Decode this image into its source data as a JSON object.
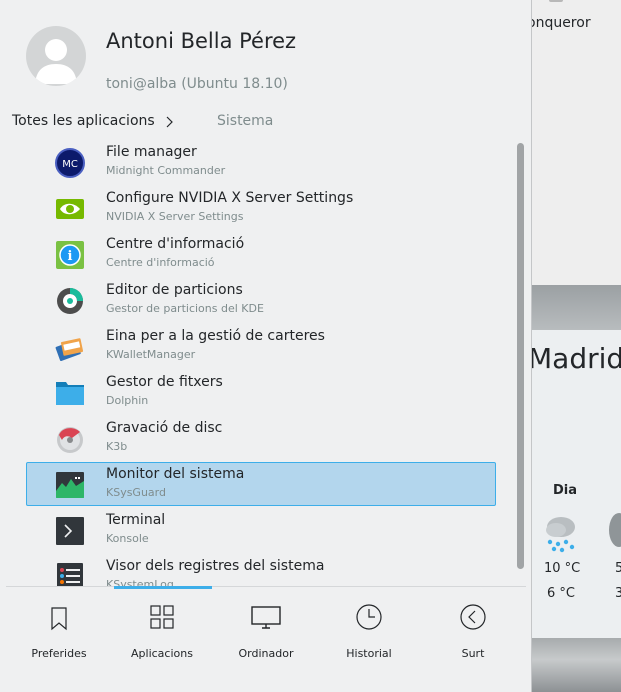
{
  "background": {
    "window_title_fragment": "onqueror",
    "weather": {
      "city": "Madrid",
      "day_label": "Dia",
      "high": "10 °C",
      "low": "6 °C",
      "next_high": "5",
      "next_low": "3"
    }
  },
  "user": {
    "name": "Antoni Bella Pérez",
    "host": "toni@alba (Ubuntu 18.10)",
    "avatar_icon": "user-avatar-icon"
  },
  "breadcrumb": {
    "root": "Totes les aplicacions",
    "separator_icon": "chevron-right-icon",
    "current": "Sistema"
  },
  "apps": [
    {
      "name": "File manager",
      "description": "Midnight Commander",
      "icon": "midnight-commander-icon"
    },
    {
      "name": "Configure NVIDIA X Server Settings",
      "description": "NVIDIA X Server Settings",
      "icon": "nvidia-icon"
    },
    {
      "name": "Centre d'informació",
      "description": "Centre d'informació",
      "icon": "info-center-icon"
    },
    {
      "name": "Editor de particions",
      "description": "Gestor de particions del KDE",
      "icon": "partition-manager-icon"
    },
    {
      "name": "Eina per a la gestió de carteres",
      "description": "KWalletManager",
      "icon": "kwallet-icon"
    },
    {
      "name": "Gestor de fitxers",
      "description": "Dolphin",
      "icon": "folder-icon"
    },
    {
      "name": "Gravació de disc",
      "description": "K3b",
      "icon": "k3b-disc-icon"
    },
    {
      "name": "Monitor del sistema",
      "description": "KSysGuard",
      "icon": "system-monitor-icon",
      "selected": true
    },
    {
      "name": "Terminal",
      "description": "Konsole",
      "icon": "terminal-icon"
    },
    {
      "name": "Visor dels registres del sistema",
      "description": "KSystemLog",
      "icon": "system-log-icon"
    }
  ],
  "tabs": [
    {
      "label": "Preferides",
      "icon": "bookmark-icon"
    },
    {
      "label": "Aplicacions",
      "icon": "applications-grid-icon",
      "active": true
    },
    {
      "label": "Ordinador",
      "icon": "computer-monitor-icon"
    },
    {
      "label": "Historial",
      "icon": "clock-icon"
    },
    {
      "label": "Surt",
      "icon": "leave-icon"
    }
  ],
  "colors": {
    "accent": "#3daee9",
    "selection": "#b3d6ed",
    "panel_bg": "#eff0f1",
    "text": "#232629",
    "muted_text": "#7f8c8d"
  }
}
